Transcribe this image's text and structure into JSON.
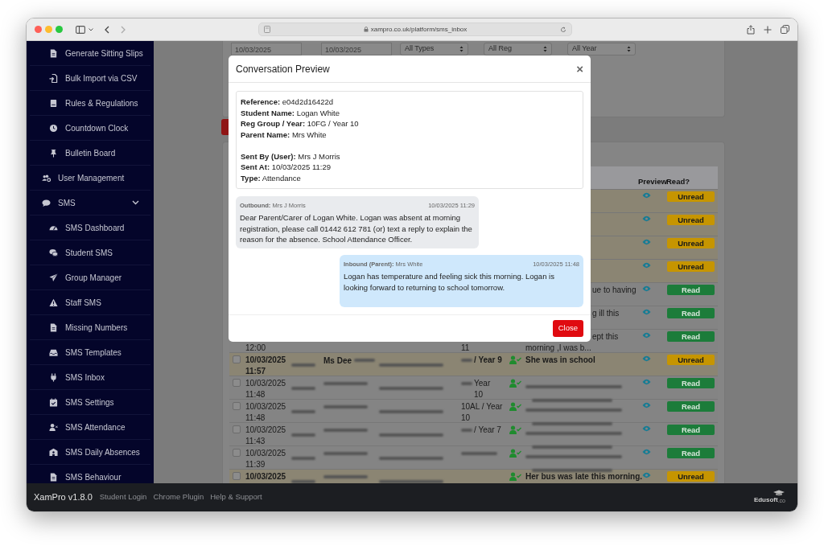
{
  "browser": {
    "url": "xampro.co.uk/platform/sms_inbox"
  },
  "sidebar": {
    "items": [
      {
        "children": [
          {
            "label": "Generate Sitting Slips"
          },
          {
            "label": "Bulk Import via CSV"
          },
          {
            "label": "Rules & Regulations"
          },
          {
            "label": "Countdown Clock"
          },
          {
            "label": "Bulletin Board"
          }
        ]
      },
      {
        "label": "User Management"
      },
      {
        "label": "SMS",
        "expanded": true,
        "children": [
          {
            "label": "SMS Dashboard"
          },
          {
            "label": "Student SMS"
          },
          {
            "label": "Group Manager"
          },
          {
            "label": "Staff SMS"
          },
          {
            "label": "Missing Numbers"
          },
          {
            "label": "SMS Templates"
          },
          {
            "label": "SMS Inbox"
          },
          {
            "label": "SMS Settings"
          },
          {
            "label": "SMS Attendance"
          },
          {
            "label": "SMS Daily Absences"
          },
          {
            "label": "SMS Behaviour"
          }
        ]
      }
    ]
  },
  "filters": {
    "date_from": "10/03/2025",
    "date_to": "10/03/2025",
    "selects": [
      "All Types",
      "All Reg",
      "All Year"
    ]
  },
  "table": {
    "columns": [
      "Preview",
      "Read?"
    ],
    "rows": [
      {
        "unread": true,
        "badge": "Unread"
      },
      {
        "unread": true,
        "badge": "Unread"
      },
      {
        "unread": true,
        "badge": "Unread"
      },
      {
        "unread": true,
        "badge": "Unread"
      },
      {
        "unread": false,
        "badge": "Read",
        "message_fragment": "ue to having"
      },
      {
        "unread": false,
        "badge": "Read",
        "message_fragment": "g ill this"
      },
      {
        "unread": false,
        "badge": "Read",
        "date_line2": "12:00",
        "reg_line2": "11",
        "message_fragment": "ept this",
        "message_lines": [
          "morning ,I was b..."
        ]
      },
      {
        "checked": false,
        "unread": true,
        "badge": "Unread",
        "date_lines": [
          "10/03/2025",
          "11:57"
        ],
        "name": "Ms Dee",
        "reg_redacted": true,
        "reg_lines": [
          "/ Year 9"
        ],
        "person_check": true,
        "message_lines": [
          "She was in school"
        ]
      },
      {
        "checked": false,
        "unread": false,
        "badge": "Read",
        "date_lines": [
          "10/03/2025",
          "11:48"
        ],
        "reg_redacted": true,
        "reg_lines": [
          "Year",
          "10"
        ],
        "person_check": true,
        "message_redacted": true
      },
      {
        "checked": false,
        "unread": false,
        "badge": "Read",
        "date_lines": [
          "10/03/2025",
          "11:48"
        ],
        "reg_redacted": false,
        "reg_lines": [
          "10AL / Year",
          "10"
        ],
        "person_check": true,
        "message_redacted": true
      },
      {
        "checked": false,
        "unread": false,
        "badge": "Read",
        "date_lines": [
          "10/03/2025",
          "11:43"
        ],
        "reg_redacted": true,
        "reg_lines": [
          "/ Year 7"
        ],
        "person_check": true,
        "message_redacted": true
      },
      {
        "checked": false,
        "unread": false,
        "badge": "Read",
        "date_lines": [
          "10/03/2025",
          "11:39"
        ],
        "reg_redacted": true,
        "person_check": true,
        "message_redacted": true
      },
      {
        "checked": false,
        "unread": true,
        "badge": "Unread",
        "date_lines": [
          "10/03/2025"
        ],
        "person_check": true,
        "message_lines": [
          "Her bus was late this morning."
        ]
      }
    ]
  },
  "modal": {
    "title": "Conversation Preview",
    "close": "×",
    "info_groups": [
      [
        "**Reference:** e04d2d16422d",
        "**Student Name:** Logan White",
        "**Reg Group / Year:** 10FG / Year 10",
        "**Parent Name:** Mrs White"
      ],
      [
        "**Sent By (User):** Mrs J Morris",
        "**Sent At:** 10/03/2025 11:29",
        "**Type:** Attendance"
      ]
    ],
    "messages": [
      {
        "kind": "outbound",
        "sender": "**Outbound:** Mrs J Morris",
        "time": "10/03/2025 11:29",
        "text": "Dear Parent/Carer of Logan White. Logan was absent at morning registration, please call 01442 612 781 (or) text a reply to explain the reason for the absence. School Attendance Officer."
      },
      {
        "kind": "inbound",
        "sender": "**Inbound (Parent):** Mrs White",
        "time": "10/03/2025 11:48",
        "text": "Logan has temperature and feeling sick this morning. Logan is looking forward to returning to school tomorrow."
      }
    ],
    "button": "Close"
  },
  "footer": {
    "brand": "XamPro v1.8.0",
    "links": [
      "Student Login",
      "Chrome Plugin",
      "Help & Support"
    ],
    "logo_text": "Edusoft",
    "logo_suffix": ".co"
  }
}
